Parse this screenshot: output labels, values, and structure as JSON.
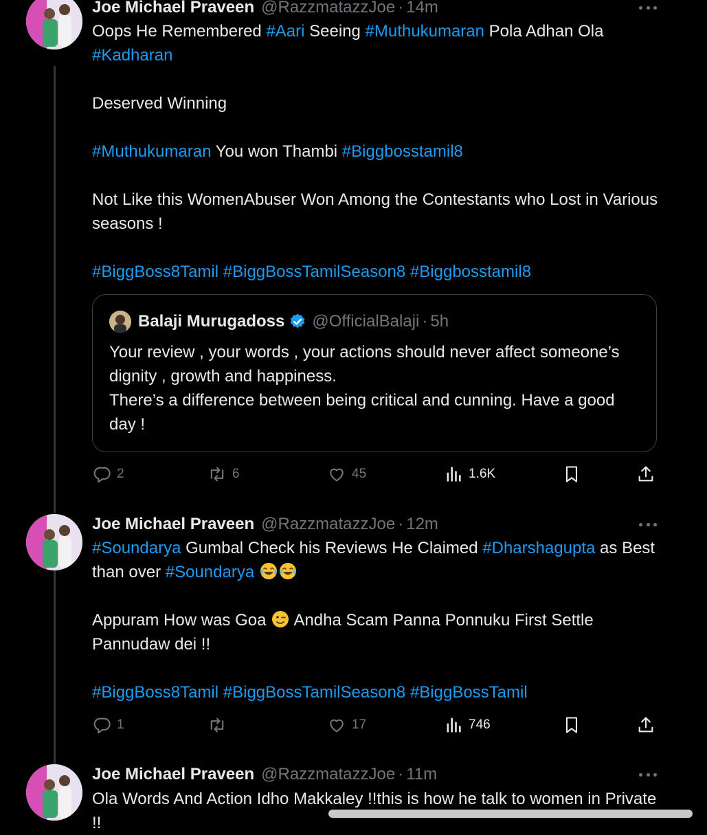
{
  "tweets": [
    {
      "name": "Joe Michael Praveen",
      "handle": "@RazzmatazzJoe",
      "time": "14m",
      "lines": [
        [
          {
            "t": "Oops He Remembered "
          },
          {
            "t": "#Aari",
            "tag": true
          },
          {
            "t": " Seeing "
          },
          {
            "t": "#Muthukumaran",
            "tag": true
          },
          {
            "t": " Pola Adhan Ola "
          },
          {
            "t": "#Kadharan",
            "tag": true
          }
        ],
        [],
        [
          {
            "t": "Deserved Winning"
          }
        ],
        [],
        [
          {
            "t": "#Muthukumaran",
            "tag": true
          },
          {
            "t": " You won Thambi  "
          },
          {
            "t": "#Biggbosstamil8",
            "tag": true
          }
        ],
        [],
        [
          {
            "t": "Not Like this WomenAbuser Won Among the  Contestants who Lost in Various  seasons !"
          }
        ],
        [],
        [
          {
            "t": "#BiggBoss8Tamil",
            "tag": true
          },
          {
            "t": " "
          },
          {
            "t": "#BiggBossTamilSeason8",
            "tag": true
          },
          {
            "t": " "
          },
          {
            "t": "#Biggbosstamil8",
            "tag": true
          }
        ]
      ],
      "quote": {
        "name": "Balaji Murugadoss",
        "handle": "@OfficialBalaji",
        "time": "5h",
        "lines": [
          "Your review , your words , your actions should never affect someone’s dignity , growth and happiness.",
          "There’s a difference between being critical and cunning. Have a good day !"
        ]
      },
      "stats": {
        "replies": "2",
        "reposts": "6",
        "likes": "45",
        "views": "1.6K"
      }
    },
    {
      "name": "Joe Michael Praveen",
      "handle": "@RazzmatazzJoe",
      "time": "12m",
      "lines": [
        [
          {
            "t": "#Soundarya",
            "tag": true
          },
          {
            "t": " Gumbal Check his Reviews He Claimed "
          },
          {
            "t": "#Dharshagupta",
            "tag": true
          },
          {
            "t": " as Best than over "
          },
          {
            "t": "#Soundarya",
            "tag": true
          },
          {
            "t": " "
          },
          {
            "emoji": "joy"
          },
          {
            "emoji": "joy"
          }
        ],
        [],
        [
          {
            "t": "Appuram How was Goa "
          },
          {
            "emoji": "wink"
          },
          {
            "t": " Andha Scam Panna Ponnuku First Settle Pannudaw dei !!"
          }
        ],
        [],
        [
          {
            "t": "#BiggBoss8Tamil",
            "tag": true
          },
          {
            "t": " "
          },
          {
            "t": "#BiggBossTamilSeason8",
            "tag": true
          },
          {
            "t": " "
          },
          {
            "t": "#BiggBossTamil",
            "tag": true
          }
        ]
      ],
      "stats": {
        "replies": "1",
        "reposts": "",
        "likes": "17",
        "views": "746"
      }
    },
    {
      "name": "Joe Michael Praveen",
      "handle": "@RazzmatazzJoe",
      "time": "11m",
      "lines": [
        [
          {
            "t": "Ola  Words  And Action Idho Makkaley !!this is how he talk to women in Private !!"
          }
        ]
      ]
    }
  ],
  "separator": "·",
  "icons": {
    "reply": "reply-icon",
    "repost": "repost-icon",
    "like": "like-icon",
    "views": "views-icon",
    "bookmark": "bookmark-icon",
    "share": "share-icon",
    "more": "more-icon",
    "verified": "verified-badge-icon"
  },
  "colors": {
    "background": "#000000",
    "text": "#e7e9ea",
    "muted": "#71767b",
    "link": "#1d9bf0",
    "verified": "#1d9bf0"
  }
}
